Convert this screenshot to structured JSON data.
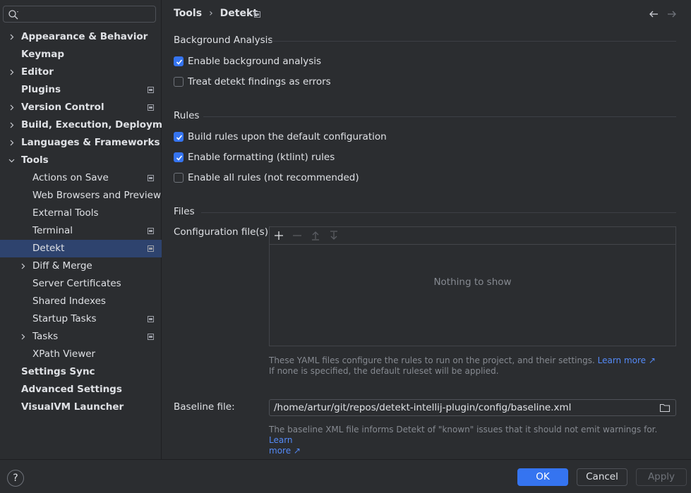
{
  "sidebar": {
    "search_placeholder": "",
    "items": [
      {
        "label": "Appearance & Behavior",
        "level": 0,
        "expandable": true,
        "expanded": false,
        "pinned": false,
        "bold": true
      },
      {
        "label": "Keymap",
        "level": 0,
        "expandable": false,
        "pinned": false,
        "bold": true
      },
      {
        "label": "Editor",
        "level": 0,
        "expandable": true,
        "expanded": false,
        "pinned": false,
        "bold": true
      },
      {
        "label": "Plugins",
        "level": 0,
        "expandable": false,
        "pinned": true,
        "bold": true
      },
      {
        "label": "Version Control",
        "level": 0,
        "expandable": true,
        "expanded": false,
        "pinned": true,
        "bold": true
      },
      {
        "label": "Build, Execution, Deployment",
        "level": 0,
        "expandable": true,
        "expanded": false,
        "pinned": false,
        "bold": true
      },
      {
        "label": "Languages & Frameworks",
        "level": 0,
        "expandable": true,
        "expanded": false,
        "pinned": false,
        "bold": true
      },
      {
        "label": "Tools",
        "level": 0,
        "expandable": true,
        "expanded": true,
        "pinned": false,
        "bold": true
      },
      {
        "label": "Actions on Save",
        "level": 1,
        "expandable": false,
        "pinned": true
      },
      {
        "label": "Web Browsers and Preview",
        "level": 1,
        "expandable": false,
        "pinned": false
      },
      {
        "label": "External Tools",
        "level": 1,
        "expandable": false,
        "pinned": false
      },
      {
        "label": "Terminal",
        "level": 1,
        "expandable": false,
        "pinned": true
      },
      {
        "label": "Detekt",
        "level": 1,
        "expandable": false,
        "pinned": true,
        "selected": true
      },
      {
        "label": "Diff & Merge",
        "level": 1,
        "expandable": true,
        "expanded": false,
        "pinned": false
      },
      {
        "label": "Server Certificates",
        "level": 1,
        "expandable": false,
        "pinned": false
      },
      {
        "label": "Shared Indexes",
        "level": 1,
        "expandable": false,
        "pinned": false
      },
      {
        "label": "Startup Tasks",
        "level": 1,
        "expandable": false,
        "pinned": true
      },
      {
        "label": "Tasks",
        "level": 1,
        "expandable": true,
        "expanded": false,
        "pinned": true
      },
      {
        "label": "XPath Viewer",
        "level": 1,
        "expandable": false,
        "pinned": false
      },
      {
        "label": "Settings Sync",
        "level": 0,
        "expandable": false,
        "pinned": false,
        "bold": true
      },
      {
        "label": "Advanced Settings",
        "level": 0,
        "expandable": false,
        "pinned": false,
        "bold": true
      },
      {
        "label": "VisualVM Launcher",
        "level": 0,
        "expandable": false,
        "pinned": false,
        "bold": true
      }
    ]
  },
  "breadcrumb": {
    "parent": "Tools",
    "separator": "›",
    "current": "Detekt"
  },
  "sections": {
    "background": {
      "title": "Background Analysis",
      "enable_background": {
        "label": "Enable background analysis",
        "checked": true
      },
      "treat_errors": {
        "label": "Treat detekt findings as errors",
        "checked": false
      }
    },
    "rules": {
      "title": "Rules",
      "build_default": {
        "label": "Build rules upon the default configuration",
        "checked": true
      },
      "formatting": {
        "label": "Enable formatting (ktlint) rules",
        "checked": true
      },
      "all_rules": {
        "label": "Enable all rules (not recommended)",
        "checked": false
      }
    },
    "files": {
      "title": "Files",
      "config_label": "Configuration file(s):",
      "empty_text": "Nothing to show",
      "config_hint_line1": "These YAML files configure the rules to run on the project, and their settings.",
      "config_hint_link": "Learn more ↗",
      "config_hint_line2": "If none is specified, the default ruleset will be applied.",
      "baseline_label": "Baseline file:",
      "baseline_value": "/home/artur/git/repos/detekt-intellij-plugin/config/baseline.xml",
      "baseline_hint": "The baseline XML file informs Detekt of \"known\" issues that it should not emit warnings for.",
      "baseline_link_1": "Learn",
      "baseline_link_2": "more ↗"
    }
  },
  "footer": {
    "help": "?",
    "ok": "OK",
    "cancel": "Cancel",
    "apply": "Apply"
  },
  "colors": {
    "background": "#2b2d30",
    "selection": "#2e436e",
    "accent": "#3574f0",
    "link": "#548af7"
  }
}
